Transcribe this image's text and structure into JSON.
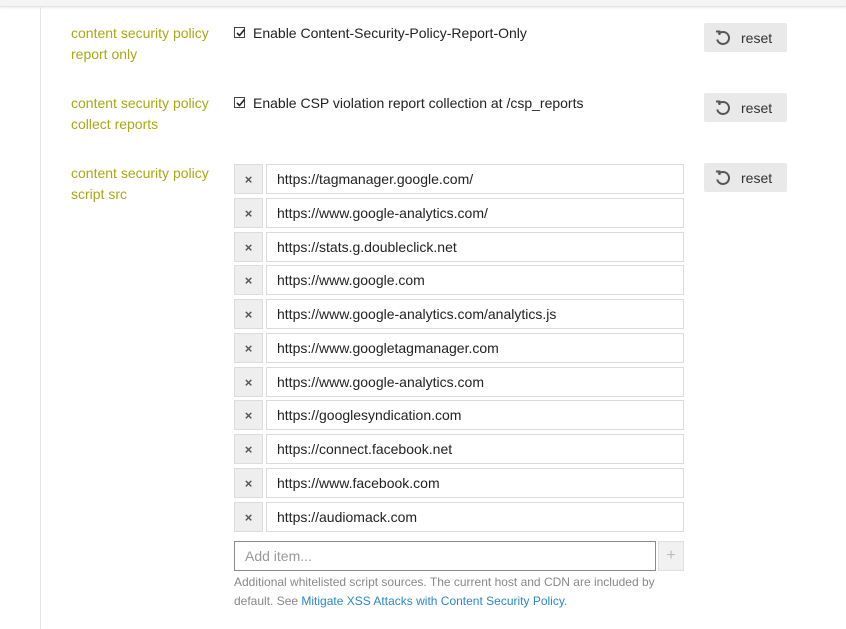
{
  "settings": {
    "report_only": {
      "label_line1": "content security policy",
      "label_line2": "report only",
      "checkbox_label": "Enable Content-Security-Policy-Report-Only",
      "checked": true,
      "reset_label": "reset"
    },
    "collect_reports": {
      "label_line1": "content security policy",
      "label_line2": "collect reports",
      "checkbox_label": "Enable CSP violation report collection at /csp_reports",
      "checked": true,
      "reset_label": "reset"
    },
    "script_src": {
      "label_line1": "content security policy",
      "label_line2": "script src",
      "reset_label": "reset",
      "remove_glyph": "×",
      "items": [
        "https://tagmanager.google.com/",
        "https://www.google-analytics.com/",
        "https://stats.g.doubleclick.net",
        "https://www.google.com",
        "https://www.google-analytics.com/analytics.js",
        "https://www.googletagmanager.com",
        "https://www.google-analytics.com",
        "https://googlesyndication.com",
        "https://connect.facebook.net",
        "https://www.facebook.com",
        "https://audiomack.com"
      ],
      "add_placeholder": "Add item...",
      "add_glyph": "+",
      "help_text": "Additional whitelisted script sources. The current host and CDN are included by default. See ",
      "help_link": "Mitigate XSS Attacks with Content Security Policy",
      "help_suffix": "."
    }
  },
  "colors": {
    "label": "#a9a814",
    "link": "#2a88c8"
  }
}
